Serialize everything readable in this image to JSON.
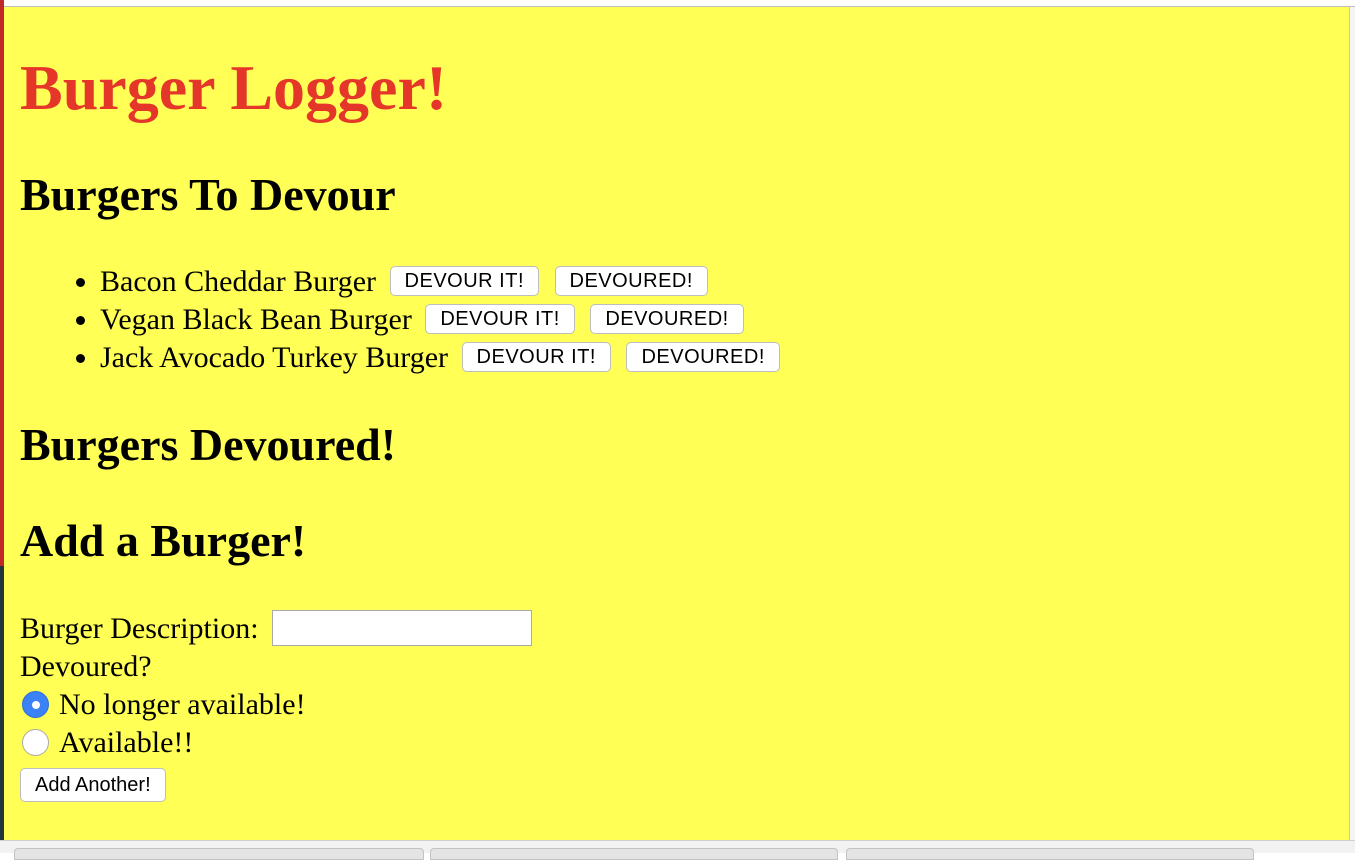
{
  "page": {
    "title": "Burger Logger!",
    "colors": {
      "background": "#ffff55",
      "title": "#e5362a"
    }
  },
  "to_devour": {
    "heading": "Burgers To Devour",
    "items": [
      {
        "name": "Bacon Cheddar Burger",
        "devour_label": "DEVOUR IT!",
        "devoured_label": "DEVOURED!"
      },
      {
        "name": "Vegan Black Bean Burger",
        "devour_label": "DEVOUR IT!",
        "devoured_label": "DEVOURED!"
      },
      {
        "name": "Jack Avocado Turkey Burger",
        "devour_label": "DEVOUR IT!",
        "devoured_label": "DEVOURED!"
      }
    ]
  },
  "devoured": {
    "heading": "Burgers Devoured!"
  },
  "add_form": {
    "heading": "Add a Burger!",
    "description_label": "Burger Description:",
    "description_value": "",
    "devoured_question": "Devoured?",
    "options": [
      {
        "label": "No longer available!",
        "checked": true
      },
      {
        "label": "Available!!",
        "checked": false
      }
    ],
    "submit_label": "Add Another!"
  }
}
